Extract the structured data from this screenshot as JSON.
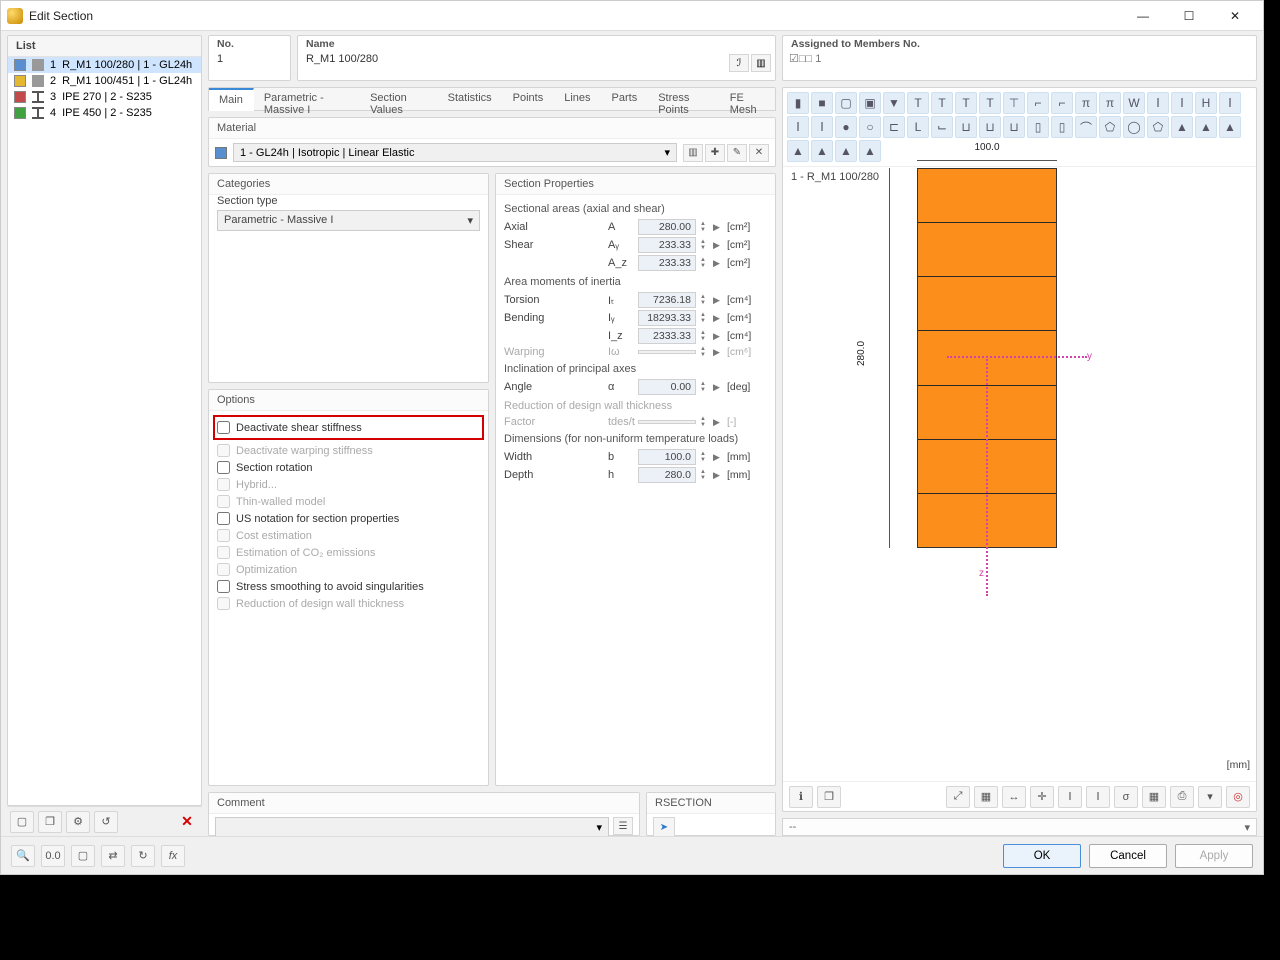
{
  "window": {
    "title": "Edit Section"
  },
  "header": {
    "no_label": "No.",
    "no_value": "1",
    "name_label": "Name",
    "name_value": "R_M1 100/280",
    "assigned_label": "Assigned to Members No.",
    "assigned_value": "☑□□ 1"
  },
  "list": {
    "header": "List",
    "items": [
      {
        "idx": "1",
        "text": "R_M1 100/280 | 1 - GL24h",
        "color": "#5a8fcf",
        "shape": "rect",
        "selected": true
      },
      {
        "idx": "2",
        "text": "R_M1 100/451 | 1 - GL24h",
        "color": "#e3b830",
        "shape": "rect",
        "selected": false
      },
      {
        "idx": "3",
        "text": "IPE 270 | 2 - S235",
        "color": "#c24a4a",
        "shape": "I",
        "selected": false
      },
      {
        "idx": "4",
        "text": "IPE 450 | 2 - S235",
        "color": "#3fa13f",
        "shape": "I",
        "selected": false
      }
    ]
  },
  "tabs": [
    "Main",
    "Parametric - Massive I",
    "Section Values",
    "Statistics",
    "Points",
    "Lines",
    "Parts",
    "Stress Points",
    "FE Mesh"
  ],
  "material": {
    "header": "Material",
    "value": "1 - GL24h | Isotropic | Linear Elastic"
  },
  "categories": {
    "header": "Categories",
    "section_type_label": "Section type",
    "section_type_value": "Parametric - Massive I"
  },
  "options": {
    "header": "Options",
    "items": [
      {
        "label": "Deactivate shear stiffness",
        "disabled": false,
        "checked": false,
        "highlighted": true
      },
      {
        "label": "Deactivate warping stiffness",
        "disabled": true,
        "checked": false
      },
      {
        "label": "Section rotation",
        "disabled": false,
        "checked": false
      },
      {
        "label": "Hybrid...",
        "disabled": true,
        "checked": false
      },
      {
        "label": "Thin-walled model",
        "disabled": true,
        "checked": false
      },
      {
        "label": "US notation for section properties",
        "disabled": false,
        "checked": false
      },
      {
        "label": "Cost estimation",
        "disabled": true,
        "checked": false
      },
      {
        "label": "Estimation of CO₂ emissions",
        "disabled": true,
        "checked": false
      },
      {
        "label": "Optimization",
        "disabled": true,
        "checked": false
      },
      {
        "label": "Stress smoothing to avoid singularities",
        "disabled": false,
        "checked": false
      },
      {
        "label": "Reduction of design wall thickness",
        "disabled": true,
        "checked": false
      }
    ]
  },
  "props": {
    "header": "Section Properties",
    "groups": [
      {
        "title": "Sectional areas (axial and shear)",
        "rows": [
          {
            "name": "Axial",
            "sym": "A",
            "val": "280.00",
            "unit": "[cm²]"
          },
          {
            "name": "Shear",
            "sym": "Aᵧ",
            "val": "233.33",
            "unit": "[cm²]"
          },
          {
            "name": "",
            "sym": "A_z",
            "val": "233.33",
            "unit": "[cm²]"
          }
        ]
      },
      {
        "title": "Area moments of inertia",
        "rows": [
          {
            "name": "Torsion",
            "sym": "Iₜ",
            "val": "7236.18",
            "unit": "[cm⁴]"
          },
          {
            "name": "Bending",
            "sym": "Iᵧ",
            "val": "18293.33",
            "unit": "[cm⁴]"
          },
          {
            "name": "",
            "sym": "I_z",
            "val": "2333.33",
            "unit": "[cm⁴]"
          },
          {
            "name": "Warping",
            "sym": "Iω",
            "val": "",
            "unit": "[cm⁶]",
            "disabled": true
          }
        ]
      },
      {
        "title": "Inclination of principal axes",
        "rows": [
          {
            "name": "Angle",
            "sym": "α",
            "val": "0.00",
            "unit": "[deg]"
          }
        ]
      },
      {
        "title": "Reduction of design wall thickness",
        "disabled": true,
        "rows": [
          {
            "name": "Factor",
            "sym": "tdes/t",
            "val": "",
            "unit": "[-]",
            "disabled": true
          }
        ]
      },
      {
        "title": "Dimensions (for non-uniform temperature loads)",
        "rows": [
          {
            "name": "Width",
            "sym": "b",
            "val": "100.0",
            "unit": "[mm]"
          },
          {
            "name": "Depth",
            "sym": "h",
            "val": "280.0",
            "unit": "[mm]"
          }
        ]
      }
    ]
  },
  "comment": {
    "header": "Comment",
    "value": ""
  },
  "rsection": {
    "header": "RSECTION"
  },
  "preview": {
    "label": "1 - R_M1 100/280",
    "width_dim": "100.0",
    "height_dim": "280.0",
    "unit": "[mm]",
    "status": "--"
  },
  "buttons": {
    "ok": "OK",
    "cancel": "Cancel",
    "apply": "Apply"
  }
}
